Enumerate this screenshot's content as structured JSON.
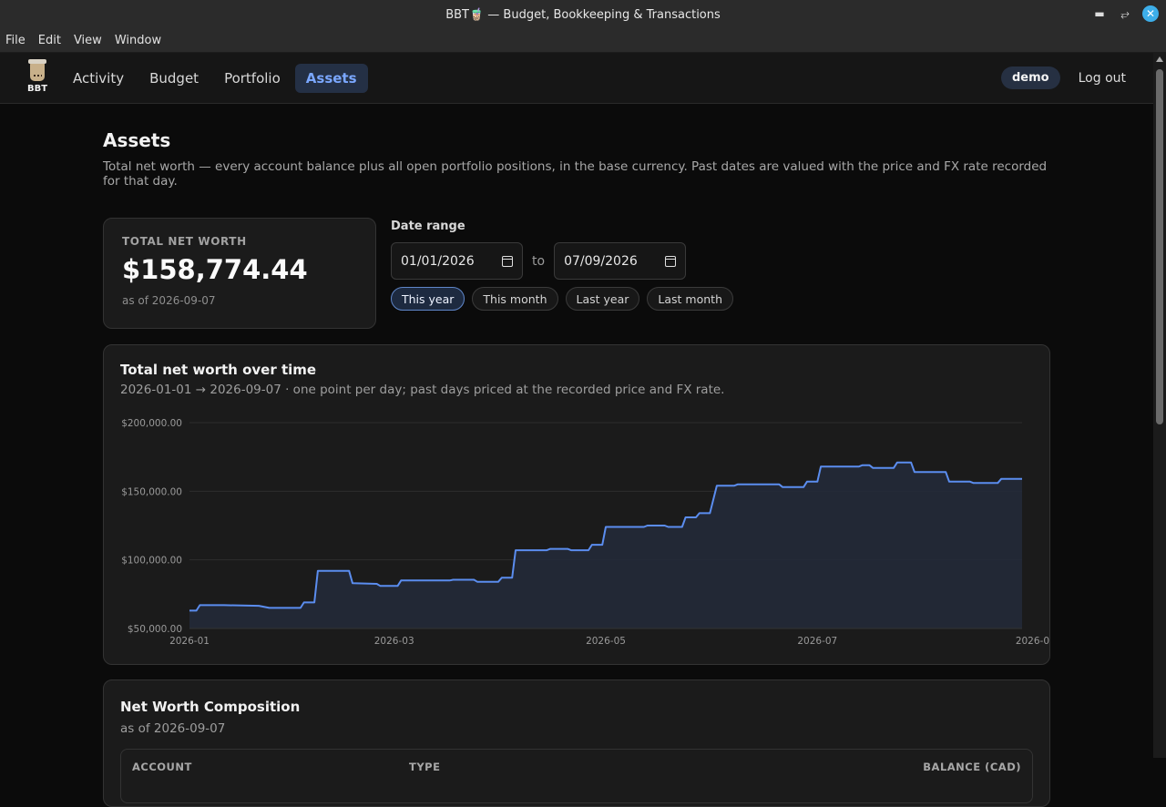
{
  "window": {
    "title": "BBT🧋 — Budget, Bookkeeping & Transactions"
  },
  "menu": [
    "File",
    "Edit",
    "View",
    "Window"
  ],
  "nav": {
    "logo_text": "BBT",
    "links": [
      "Activity",
      "Budget",
      "Portfolio",
      "Assets"
    ],
    "active": "Assets",
    "user": "demo",
    "logout": "Log out"
  },
  "page": {
    "title": "Assets",
    "description": "Total net worth — every account balance plus all open portfolio positions, in the base currency. Past dates are valued with the price and FX rate recorded for that day."
  },
  "networth": {
    "label": "TOTAL NET WORTH",
    "value": "$158,774.44",
    "as_of": "as of 2026-09-07"
  },
  "range": {
    "label": "Date range",
    "from": "01/01/2026",
    "to": "07/09/2026",
    "to_word": "to",
    "presets": [
      "This year",
      "This month",
      "Last year",
      "Last month"
    ],
    "active_preset": "This year"
  },
  "chart": {
    "title": "Total net worth over time",
    "subtitle": "2026-01-01 → 2026-09-07 · one point per day; past days priced at the recorded price and FX rate.",
    "line_color": "#5b8def",
    "fill_color": "#232a38"
  },
  "chart_data": {
    "type": "area",
    "title": "Total net worth over time",
    "ylim": [
      50000,
      200000
    ],
    "y_ticks": [
      "$200,000.00",
      "$150,000.00",
      "$100,000.00",
      "$50,000.00"
    ],
    "y_tick_values": [
      200000,
      150000,
      100000,
      50000
    ],
    "x_ticks": [
      "2026-01",
      "2026-03",
      "2026-05",
      "2026-07",
      "2026-0"
    ],
    "x_tick_days": [
      0,
      59,
      120,
      181,
      243
    ],
    "x_range_days": [
      0,
      240
    ],
    "series": [
      {
        "points": [
          [
            0,
            63000
          ],
          [
            2,
            63000
          ],
          [
            3,
            67000
          ],
          [
            10,
            67000
          ],
          [
            20,
            66500
          ],
          [
            23,
            65000
          ],
          [
            32,
            65000
          ],
          [
            33,
            69000
          ],
          [
            36,
            69000
          ],
          [
            37,
            92000
          ],
          [
            46,
            92000
          ],
          [
            47,
            83000
          ],
          [
            54,
            82500
          ],
          [
            55,
            81000
          ],
          [
            60,
            81000
          ],
          [
            61,
            85000
          ],
          [
            75,
            85000
          ],
          [
            76,
            85500
          ],
          [
            82,
            85500
          ],
          [
            83,
            84000
          ],
          [
            89,
            84000
          ],
          [
            90,
            87000
          ],
          [
            93,
            87000
          ],
          [
            94,
            107000
          ],
          [
            103,
            107000
          ],
          [
            104,
            108000
          ],
          [
            109,
            108000
          ],
          [
            110,
            107000
          ],
          [
            115,
            107000
          ],
          [
            116,
            111000
          ],
          [
            119,
            111000
          ],
          [
            120,
            124000
          ],
          [
            131,
            124000
          ],
          [
            132,
            125000
          ],
          [
            137,
            125000
          ],
          [
            138,
            124000
          ],
          [
            142,
            124000
          ],
          [
            143,
            131000
          ],
          [
            146,
            131000
          ],
          [
            147,
            134000
          ],
          [
            150,
            134000
          ],
          [
            152,
            154000
          ],
          [
            157,
            154000
          ],
          [
            158,
            155000
          ],
          [
            165,
            155000
          ],
          [
            166,
            155000
          ],
          [
            170,
            155000
          ],
          [
            171,
            153000
          ],
          [
            177,
            153000
          ],
          [
            178,
            157000
          ],
          [
            181,
            157000
          ],
          [
            182,
            168000
          ],
          [
            193,
            168000
          ],
          [
            194,
            169000
          ],
          [
            196,
            169000
          ],
          [
            197,
            167000
          ],
          [
            203,
            167000
          ],
          [
            204,
            171000
          ],
          [
            208,
            171000
          ],
          [
            209,
            164000
          ],
          [
            218,
            164000
          ],
          [
            219,
            157000
          ],
          [
            222,
            157000
          ],
          [
            223,
            157000
          ],
          [
            225,
            157000
          ],
          [
            226,
            156000
          ],
          [
            233,
            156000
          ],
          [
            234,
            159000
          ],
          [
            240,
            159000
          ]
        ]
      }
    ]
  },
  "composition": {
    "title": "Net Worth Composition",
    "as_of": "as of 2026-09-07",
    "columns": [
      "ACCOUNT",
      "TYPE",
      "BALANCE (CAD)"
    ]
  }
}
